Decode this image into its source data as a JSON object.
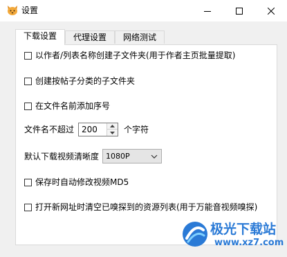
{
  "window": {
    "title": "设置",
    "app_icon": "cat-face-icon",
    "controls": {
      "minimize": "minimize-icon",
      "maximize": "maximize-icon",
      "close": "close-icon"
    }
  },
  "tabs": [
    {
      "label": "下载设置",
      "active": true
    },
    {
      "label": "代理设置",
      "active": false
    },
    {
      "label": "网络测试",
      "active": false
    }
  ],
  "options": {
    "create_author_folder": {
      "label": "以作者/列表名称创建子文件夹(用于作者主页批量提取)",
      "checked": false
    },
    "create_category_folder": {
      "label": "创建按帖子分类的子文件夹",
      "checked": false
    },
    "add_sequence_number": {
      "label": "在文件名前添加序号",
      "checked": false
    },
    "filename_limit": {
      "label": "文件名不超过",
      "value": "200",
      "unit": "个字符"
    },
    "default_resolution": {
      "label": "默认下载视频清晰度",
      "value": "1080P"
    },
    "auto_modify_md5": {
      "label": "保存时自动修改视频MD5",
      "checked": false
    },
    "clear_sniffed_list": {
      "label": "打开新网址时清空已嗅探到的资源列表(用于万能音视频嗅探)",
      "checked": false
    }
  },
  "watermark": {
    "title": "极光下载站",
    "url": "www.xz7.com"
  },
  "colors": {
    "watermark_blue": "#2a7ad6",
    "background": "#f0f0f0",
    "panel": "#ffffff"
  }
}
